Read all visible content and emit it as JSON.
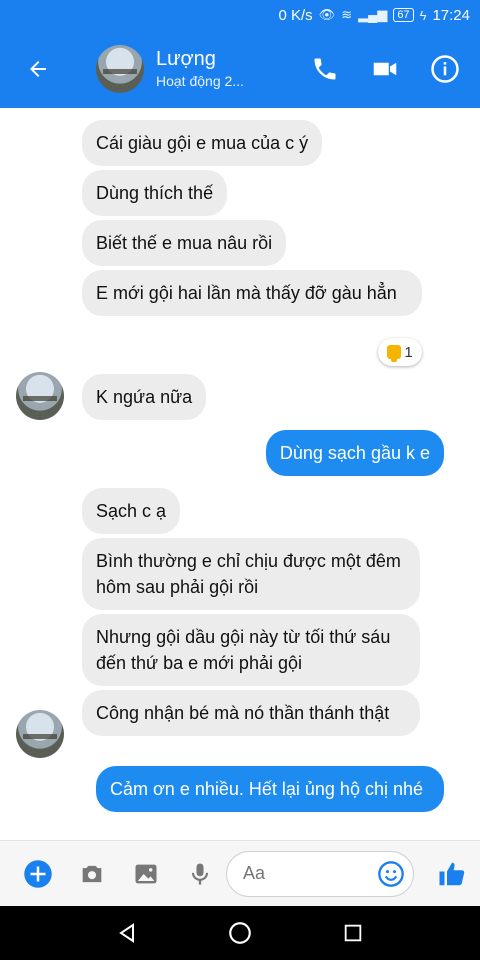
{
  "status_bar": {
    "speed": "0 K/s",
    "battery": "67",
    "time": "17:24"
  },
  "header": {
    "name": "Lượng",
    "status": "Hoạt động 2..."
  },
  "messages": [
    {
      "text": "Cái giàu gội e mua của c ý",
      "dir": "in"
    },
    {
      "text": "Dùng thích thế",
      "dir": "in"
    },
    {
      "text": "Biết thế e mua nâu rồi",
      "dir": "in"
    },
    {
      "text": "E mới gội hai lần mà thấy đỡ gàu hẳn",
      "dir": "in"
    },
    {
      "text": "K ngứa nữa",
      "dir": "in"
    },
    {
      "text": "Dùng sạch gầu k e",
      "dir": "out"
    },
    {
      "text": "Sạch c ạ",
      "dir": "in"
    },
    {
      "text": "Bình thường e chỉ chịu được một đêm hôm sau phải gội rồi",
      "dir": "in"
    },
    {
      "text": "Nhưng gội dầu gội này từ tối thứ sáu đến thứ ba  e mới phải gội",
      "dir": "in"
    },
    {
      "text": "Công nhận bé mà nó thần thánh thật",
      "dir": "in"
    },
    {
      "text": "Cảm ơn e nhiều. Hết lại ủng hộ chị nhé",
      "dir": "out"
    }
  ],
  "reaction": {
    "count": "1"
  },
  "composer": {
    "placeholder": "Aa"
  },
  "colors": {
    "brand": "#1a80f0",
    "outgoing": "#1e8bf0",
    "incoming": "#ececec"
  },
  "icons": [
    "back-arrow-icon",
    "phone-icon",
    "video-icon",
    "info-icon",
    "plus-icon",
    "camera-icon",
    "image-icon",
    "mic-icon",
    "emoji-icon",
    "like-icon"
  ]
}
